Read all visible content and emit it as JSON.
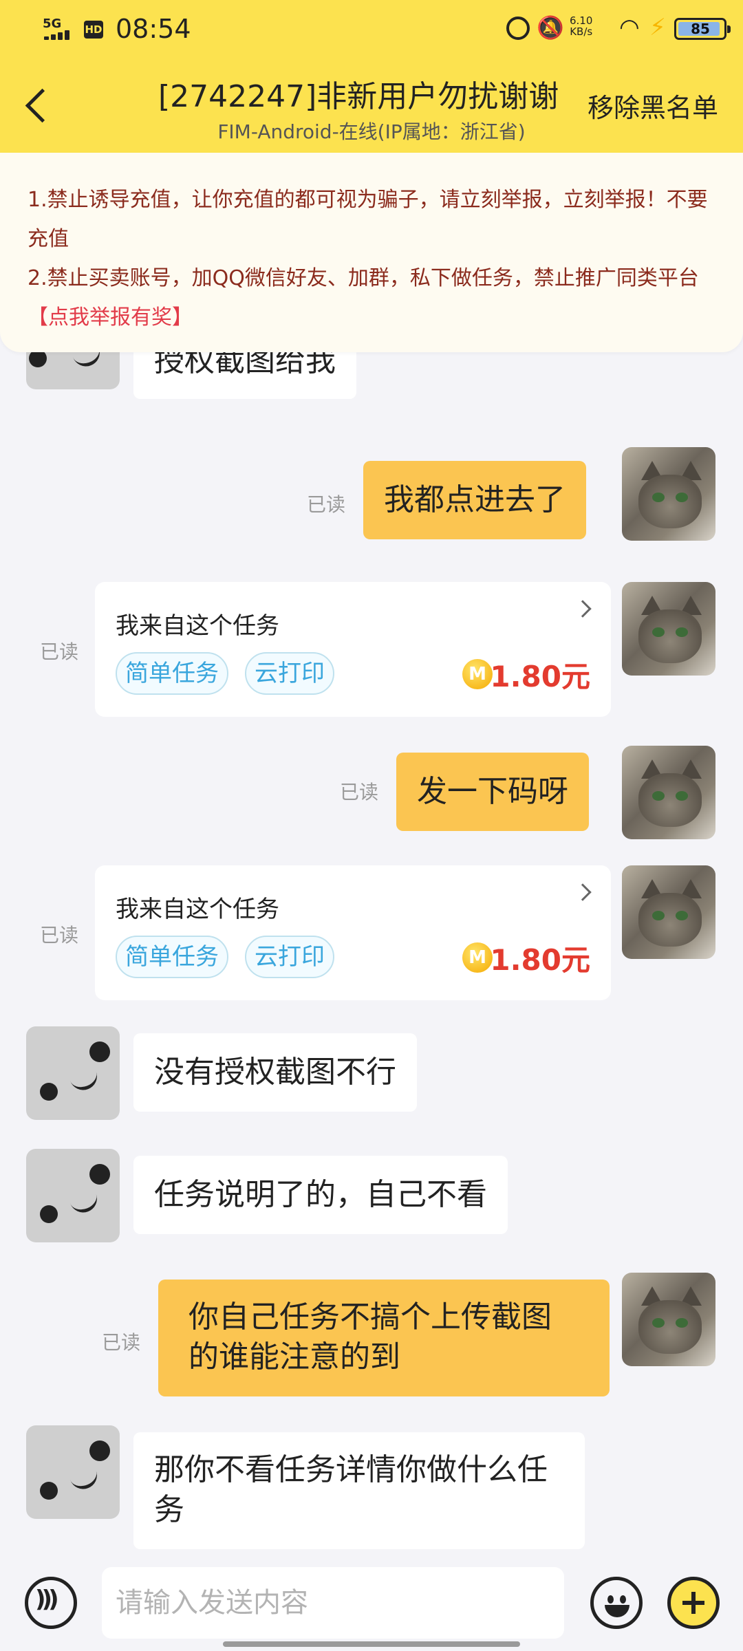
{
  "status": {
    "network": "5G",
    "hd": "HD",
    "time": "08:54",
    "speed": "6.10\nKB/s",
    "battery": "85"
  },
  "header": {
    "title": "[2742247]非新用户勿扰谢谢",
    "subtitle": "FIM-Android-在线(IP属地：浙江省)",
    "remove_label": "移除黑名单"
  },
  "notice": {
    "line1": "1.禁止诱导充值，让你充值的都可视为骗子，请立刻举报，立刻举报！不要充值",
    "line2": "2.禁止买卖账号，加QQ微信好友、加群，私下做任务，禁止推广同类平台",
    "report_link": "【点我举报有奖】"
  },
  "read_label": "已读",
  "messages": [
    {
      "side": "left",
      "text": "授权截图给我"
    },
    {
      "side": "right",
      "text": "我都点进去了",
      "read": "已读"
    },
    {
      "side": "right",
      "type": "card",
      "read": "已读",
      "title": "我来自这个任务",
      "tags": [
        "简单任务",
        "云打印"
      ],
      "coin": "M",
      "price": "1.80元"
    },
    {
      "side": "right",
      "text": "发一下码呀",
      "read": "已读"
    },
    {
      "side": "right",
      "type": "card",
      "read": "已读",
      "title": "我来自这个任务",
      "tags": [
        "简单任务",
        "云打印"
      ],
      "coin": "M",
      "price": "1.80元"
    },
    {
      "side": "left",
      "text": "没有授权截图不行"
    },
    {
      "side": "left",
      "text": "任务说明了的，自己不看"
    },
    {
      "side": "right",
      "text": "你自己任务不搞个上传截图的谁能注意的到",
      "read": "已读"
    },
    {
      "side": "left",
      "text": "那你不看任务详情你做什么任务"
    }
  ],
  "input": {
    "placeholder": "请输入发送内容"
  }
}
